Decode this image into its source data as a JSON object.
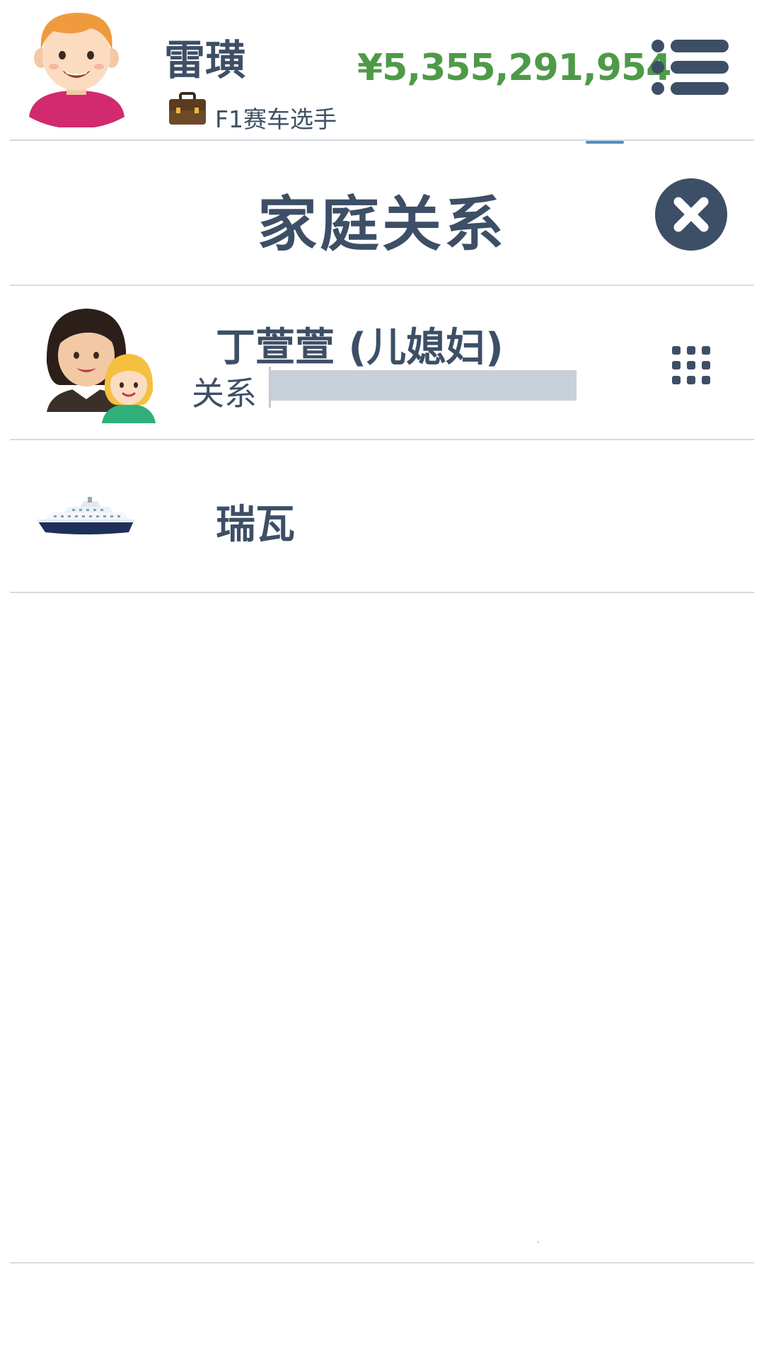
{
  "header": {
    "user_name": "雷璜",
    "job_label": "F1赛车选手",
    "money": "¥5,355,291,954",
    "icons": {
      "avatar": "male-avatar-icon",
      "job": "briefcase-icon",
      "menu": "list-menu-icon"
    }
  },
  "page": {
    "title": "家庭关系",
    "close_icon": "close-icon"
  },
  "relations": [
    {
      "name": "丁萱萱 (儿媳妇)",
      "relation_label": "关系",
      "relation_level": 0,
      "avatar_icon": "mother-daughter-avatar-icon",
      "action_icon": "grid-menu-icon"
    },
    {
      "name": "瑞瓦",
      "avatar_icon": "cruise-ship-icon"
    }
  ],
  "colors": {
    "text": "#3d4f66",
    "money": "#4e9a48",
    "divider": "#d6dadf",
    "bar": "#c8d0da",
    "accent": "#4a90c8"
  }
}
